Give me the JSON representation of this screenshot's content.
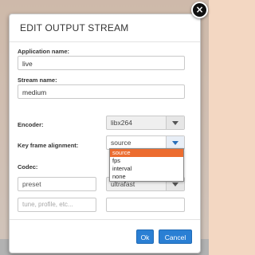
{
  "dialog": {
    "title": "EDIT OUTPUT STREAM",
    "fields": {
      "application_name_label": "Application name:",
      "application_name_value": "live",
      "stream_name_label": "Stream name:",
      "stream_name_value": "medium",
      "encoder_label": "Encoder:",
      "encoder_value": "libx264",
      "keyframe_label": "Key frame alignment:",
      "keyframe_value": "source",
      "keyframe_options": [
        "source",
        "fps",
        "interval",
        "none"
      ],
      "codec_label": "Codec:",
      "preset_value": "preset",
      "preset_select_value": "ultrafast",
      "tune_placeholder": "tune, profile, etc..."
    },
    "buttons": {
      "ok": "Ok",
      "cancel": "Cancel"
    }
  },
  "colors": {
    "accent": "#2a7fd4",
    "dropdown_selected": "#ec6c2f"
  }
}
